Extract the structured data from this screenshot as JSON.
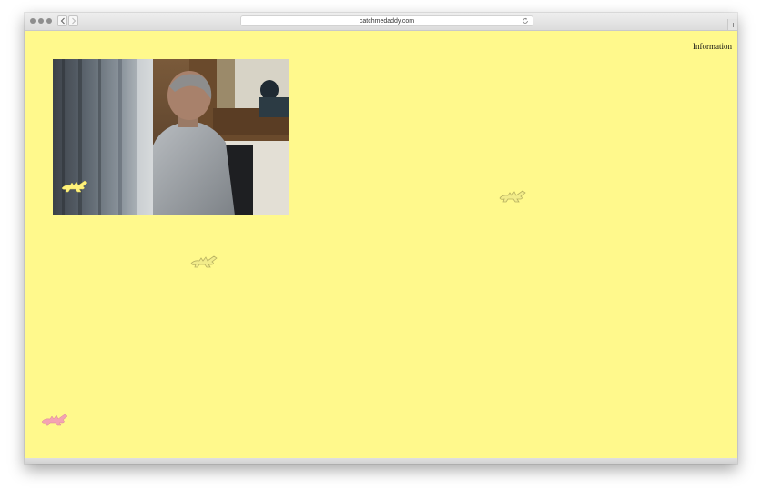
{
  "browser": {
    "url": "catchmedaddy.com"
  },
  "page": {
    "nav_link": "Information"
  },
  "colors": {
    "background": "#fff98c",
    "croc_yellow": "#fff27a",
    "croc_olive": "#e9e27e",
    "croc_pink": "#f4a3b3"
  },
  "icons": {
    "back": "chevron-left-icon",
    "forward": "chevron-right-icon",
    "reload": "reload-icon",
    "new_tab": "plus-icon",
    "crocodile": "crocodile-icon"
  }
}
